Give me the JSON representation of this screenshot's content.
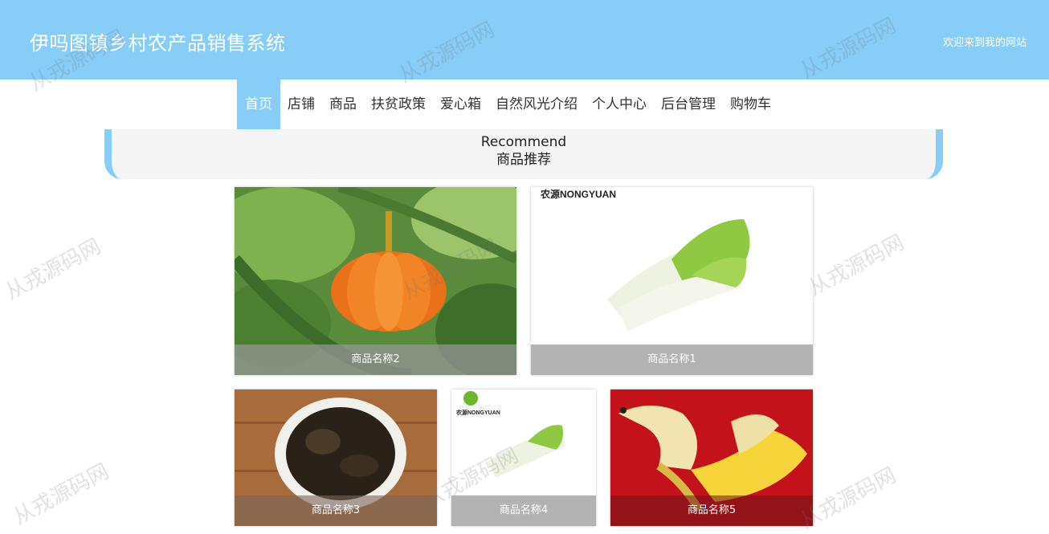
{
  "header": {
    "title": "伊吗图镇乡村农产品销售系统",
    "welcome": "欢迎来到我的网站",
    "bg_color": "#87cdf8"
  },
  "nav": {
    "items": [
      "首页",
      "店铺",
      "商品",
      "扶贫政策",
      "爱心箱",
      "自然风光介绍",
      "个人中心",
      "后台管理",
      "购物车"
    ],
    "active": "首页"
  },
  "recommend": {
    "title_en": "Recommend",
    "title_cn": "商品推荐"
  },
  "products": [
    {
      "name": "商品名称2",
      "image": "pumpkin"
    },
    {
      "name": "商品名称1",
      "image": "napa-cabbage",
      "brand": "农源NONGYUAN"
    },
    {
      "name": "商品名称3",
      "image": "black-fungus"
    },
    {
      "name": "商品名称4",
      "image": "napa-cabbage",
      "brand": "农源NONGYUAN"
    },
    {
      "name": "商品名称5",
      "image": "banana-dog"
    }
  ],
  "watermark": "从戎源码网"
}
